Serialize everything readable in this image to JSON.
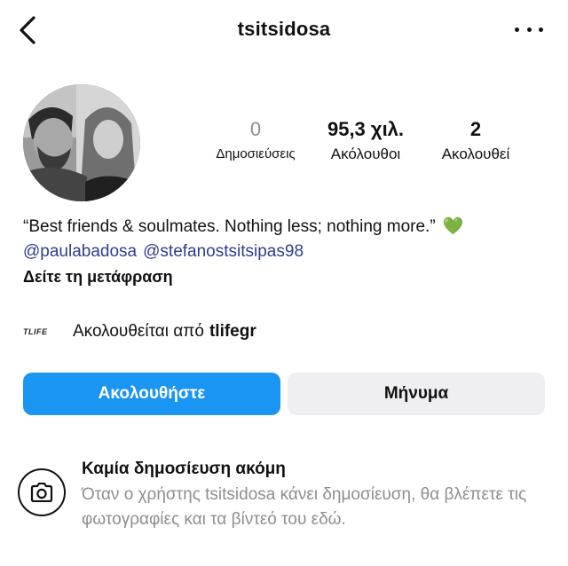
{
  "header": {
    "username": "tsitsidosa",
    "back_icon": "chevron-left-icon",
    "more_icon": "more-horizontal-icon"
  },
  "stats": {
    "posts": {
      "value": "0",
      "label": "Δημοσιεύσεις"
    },
    "followers": {
      "value": "95,3 χιλ.",
      "label": "Ακόλουθοι"
    },
    "following": {
      "value": "2",
      "label": "Ακολουθεί"
    }
  },
  "bio": {
    "text": "“Best friends & soulmates. Nothing less; nothing more.”",
    "emoji": "💚",
    "mentions": [
      "@paulabadosa",
      "@stefanostsitsipas98"
    ],
    "translate_label": "Δείτε τη μετάφραση"
  },
  "followed_by": {
    "logo_text": "TLIFE",
    "prefix": "Ακολουθείται από",
    "account": "tlifegr"
  },
  "buttons": {
    "follow": "Ακολουθήστε",
    "message": "Μήνυμα"
  },
  "empty_state": {
    "icon": "camera-icon",
    "title": "Καμία δημοσίευση ακόμη",
    "description": "Όταν ο χρήστης tsitsidosa κάνει δημοσίευση, θα βλέπετε τις φωτογραφίες και τα βίντεό του εδώ."
  },
  "colors": {
    "follow_button": "#1a95f1",
    "message_button": "#efeff1",
    "mention_link": "#2f3d8f",
    "muted_text": "#8e8e8e"
  }
}
